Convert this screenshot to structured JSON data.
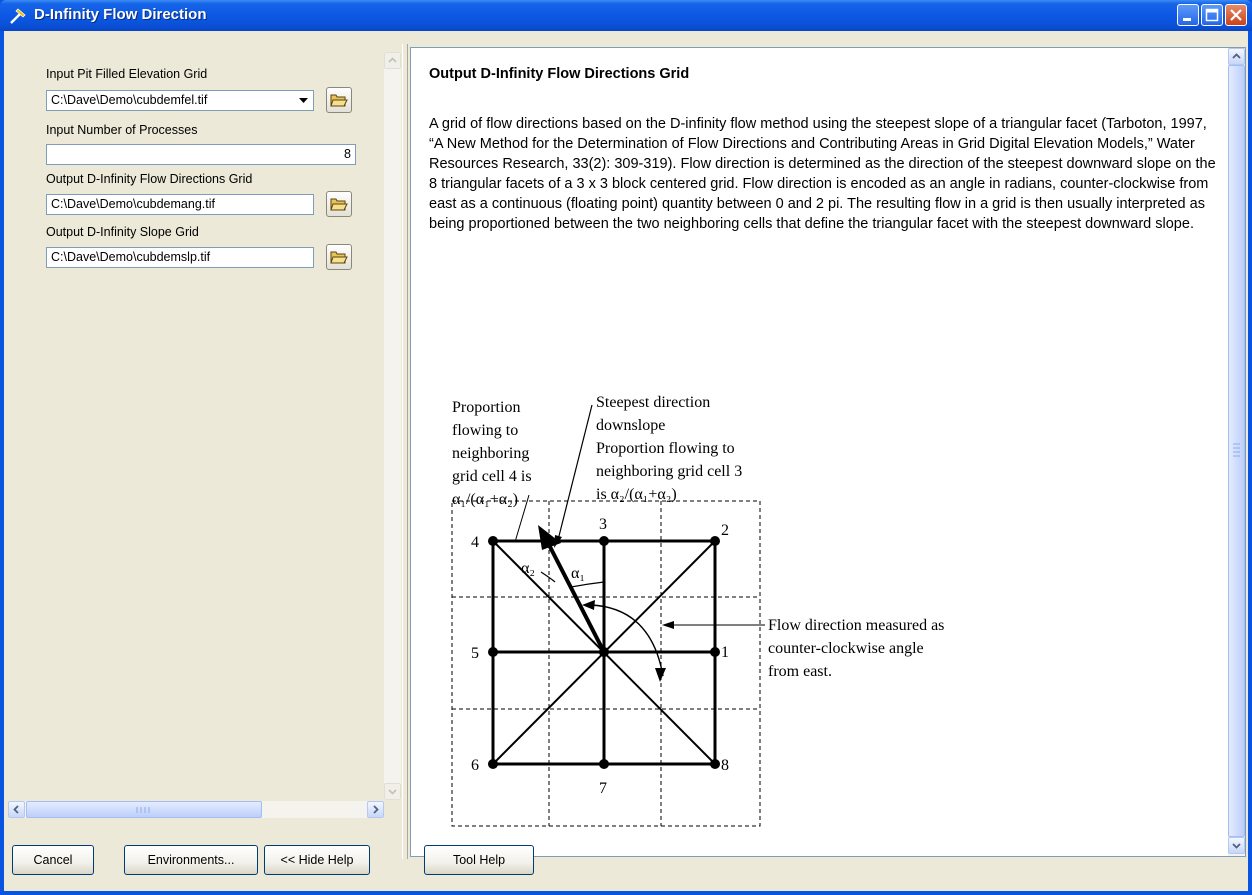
{
  "window": {
    "title": "D-Infinity Flow Direction",
    "controls": [
      "minimize",
      "maximize",
      "close"
    ]
  },
  "left_panel": {
    "fields": [
      {
        "label": "Input Pit Filled Elevation Grid",
        "value": "C:\\Dave\\Demo\\cubdemfel.tif",
        "type": "combo"
      },
      {
        "label": "Input Number of Processes",
        "value": "8",
        "type": "number"
      },
      {
        "label": "Output D-Infinity Flow Directions Grid",
        "value": "C:\\Dave\\Demo\\cubdemang.tif",
        "type": "text"
      },
      {
        "label": "Output D-Infinity Slope Grid",
        "value": "C:\\Dave\\Demo\\cubdemslp.tif",
        "type": "text"
      }
    ]
  },
  "help": {
    "title": "Output D-Infinity Flow Directions Grid",
    "body": "A grid of flow directions based on the D-infinity flow method using the steepest slope of a triangular facet (Tarboton, 1997, “A New Method for the Determination of Flow Directions and Contributing Areas in Grid Digital Elevation Models,” Water Resources Research, 33(2): 309-319). Flow direction is determined as the direction of the steepest downward slope on the 8 triangular facets of a 3 x 3 block centered grid. Flow direction is encoded as an angle in radians, counter-clockwise from east as a continuous (floating point) quantity between 0 and 2 pi. The resulting flow in a grid is then usually interpreted as being proportioned between the two neighboring cells that define the triangular facet with the steepest downward slope.",
    "diagram": {
      "left_note": [
        "Proportion",
        "flowing to",
        "neighboring",
        "grid cell 4 is",
        "α₁/(α₁+α₂)"
      ],
      "top_note": [
        "Steepest direction",
        "downslope"
      ],
      "mid_note": [
        "Proportion flowing to",
        "neighboring grid cell 3",
        "is α₂/(α₁+α₂)"
      ],
      "right_note": [
        "Flow direction measured as",
        "counter-clockwise angle",
        "from east."
      ],
      "cell_numbers": [
        "1",
        "2",
        "3",
        "4",
        "5",
        "6",
        "7",
        "8"
      ],
      "alpha_1": "α₁",
      "alpha_2": "α₂"
    }
  },
  "buttons": {
    "cancel": "Cancel",
    "environments": "Environments...",
    "hide_help": "<< Hide Help",
    "tool_help": "Tool Help"
  }
}
